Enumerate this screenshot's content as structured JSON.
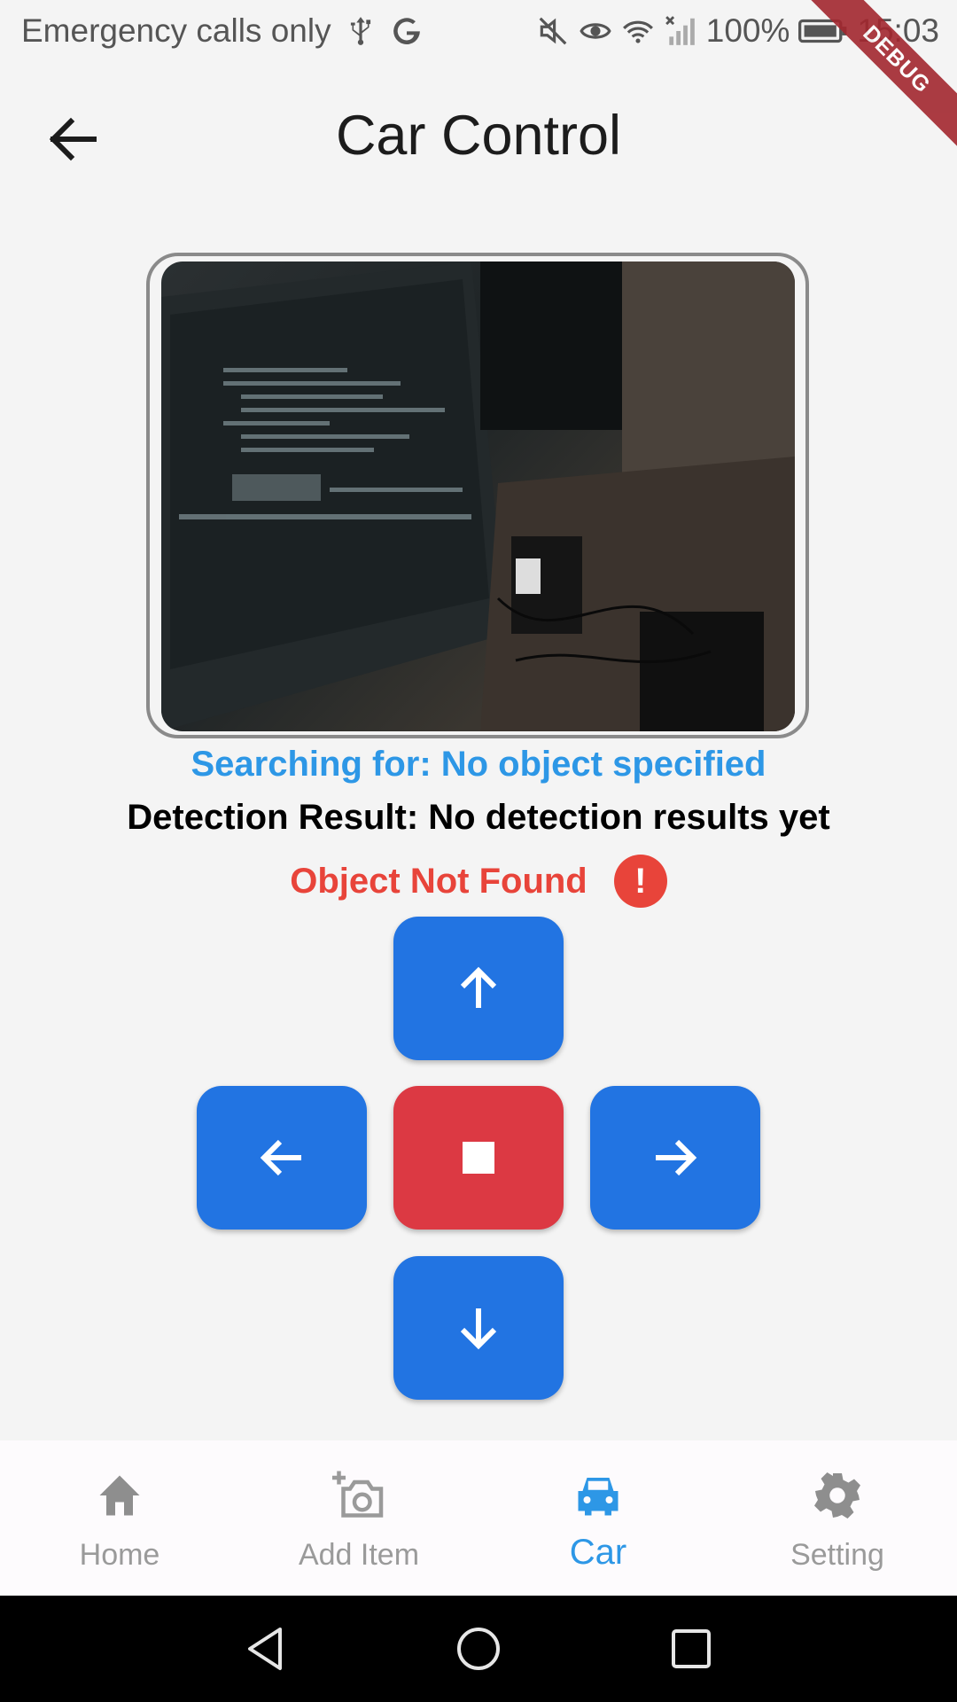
{
  "status_bar": {
    "carrier_text": "Emergency calls only",
    "battery": "100%",
    "time": "15:03",
    "debug_label": "DEBUG"
  },
  "app_bar": {
    "title": "Car Control",
    "back_icon": "arrow-back-icon"
  },
  "camera": {
    "description_icon": "camera-feed"
  },
  "detection": {
    "searching": "Searching for: No object specified",
    "result": "Detection Result: No detection results yet",
    "status": "Object Not Found",
    "status_icon": "alert-icon",
    "alert_symbol": "!"
  },
  "controls": {
    "up_icon": "arrow-up-icon",
    "left_icon": "arrow-left-icon",
    "stop_icon": "stop-icon",
    "right_icon": "arrow-right-icon",
    "down_icon": "arrow-down-icon"
  },
  "bottom_nav": {
    "items": [
      {
        "label": "Home",
        "icon": "home-icon",
        "active": false
      },
      {
        "label": "Add Item",
        "icon": "add-photo-icon",
        "active": false
      },
      {
        "label": "Car",
        "icon": "car-icon",
        "active": true
      },
      {
        "label": "Setting",
        "icon": "gear-icon",
        "active": false
      }
    ]
  },
  "colors": {
    "accent_blue": "#2274e2",
    "stop_red": "#dc3943",
    "search_text": "#2d97e6",
    "error_red": "#e8443a"
  }
}
